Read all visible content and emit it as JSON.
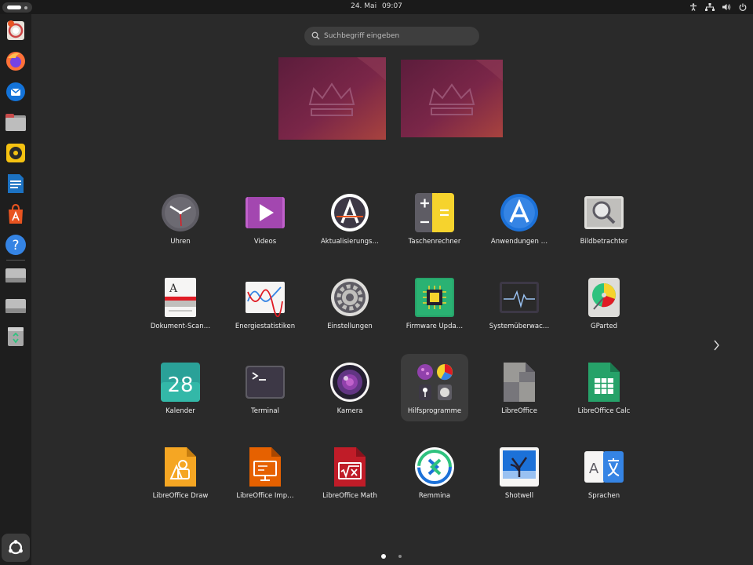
{
  "topbar": {
    "date": "24. Mai",
    "time": "09:07"
  },
  "search": {
    "placeholder": "Suchbegriff eingeben"
  },
  "apps": [
    {
      "label": "Uhren",
      "icon": "clock-icon"
    },
    {
      "label": "Videos",
      "icon": "videos-icon"
    },
    {
      "label": "Aktualisierungs…",
      "icon": "update-icon"
    },
    {
      "label": "Taschenrechner",
      "icon": "calculator-icon"
    },
    {
      "label": "Anwendungen …",
      "icon": "app-store-icon"
    },
    {
      "label": "Bildbetrachter",
      "icon": "image-viewer-icon"
    },
    {
      "label": "Dokument-Scan…",
      "icon": "scanner-icon"
    },
    {
      "label": "Energiestatistiken",
      "icon": "power-stats-icon"
    },
    {
      "label": "Einstellungen",
      "icon": "settings-gear-icon"
    },
    {
      "label": "Firmware Upda…",
      "icon": "firmware-chip-icon"
    },
    {
      "label": "Systemüberwac…",
      "icon": "system-monitor-icon"
    },
    {
      "label": "GParted",
      "icon": "gparted-disk-icon"
    },
    {
      "label": "Kalender",
      "icon": "calendar-icon"
    },
    {
      "label": "Terminal",
      "icon": "terminal-icon"
    },
    {
      "label": "Kamera",
      "icon": "camera-icon"
    },
    {
      "label": "Hilfsprogramme",
      "icon": "utilities-folder-icon"
    },
    {
      "label": "LibreOffice",
      "icon": "libreoffice-icon"
    },
    {
      "label": "LibreOffice Calc",
      "icon": "libreoffice-calc-icon"
    },
    {
      "label": "LibreOffice Draw",
      "icon": "libreoffice-draw-icon"
    },
    {
      "label": "LibreOffice Imp…",
      "icon": "libreoffice-impress-icon"
    },
    {
      "label": "LibreOffice Math",
      "icon": "libreoffice-math-icon"
    },
    {
      "label": "Remmina",
      "icon": "remmina-icon"
    },
    {
      "label": "Shotwell",
      "icon": "shotwell-icon"
    },
    {
      "label": "Sprachen",
      "icon": "language-icon"
    }
  ],
  "dock": [
    "ubuntu-help-icon",
    "firefox-icon",
    "thunderbird-icon",
    "files-icon",
    "rhythmbox-icon",
    "writer-icon",
    "app-center-icon",
    "help-icon",
    "drive-icon",
    "drive-icon",
    "trash-icon",
    "show-apps-icon"
  ],
  "pager": {
    "current": 1,
    "total": 2
  }
}
